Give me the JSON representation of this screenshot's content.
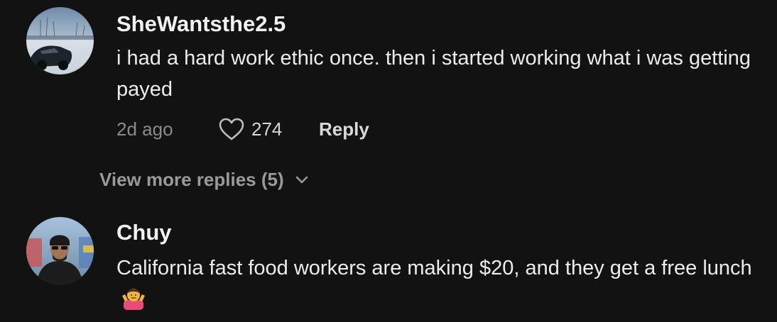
{
  "comments": [
    {
      "username": "SheWantsthe2.5",
      "text": "i had a hard work ethic once. then i started working what i was getting payed",
      "time_ago": "2d ago",
      "likes": "274",
      "reply_label": "Reply",
      "avatar_icon": "user-avatar-car-snow"
    },
    {
      "username": "Chuy",
      "text": "California fast food workers are making $20, and they get a free lunch",
      "emoji": "person-shrugging-emoji",
      "avatar_icon": "user-avatar-man-beanie"
    }
  ],
  "view_more_replies": {
    "label": "View more replies (5)",
    "icon": "chevron-down-icon"
  },
  "colors": {
    "background": "#121212",
    "username": "#f2f2f2",
    "text": "#ececec",
    "muted": "#8a8a8a",
    "heart_outline": "#bdbdbd"
  }
}
